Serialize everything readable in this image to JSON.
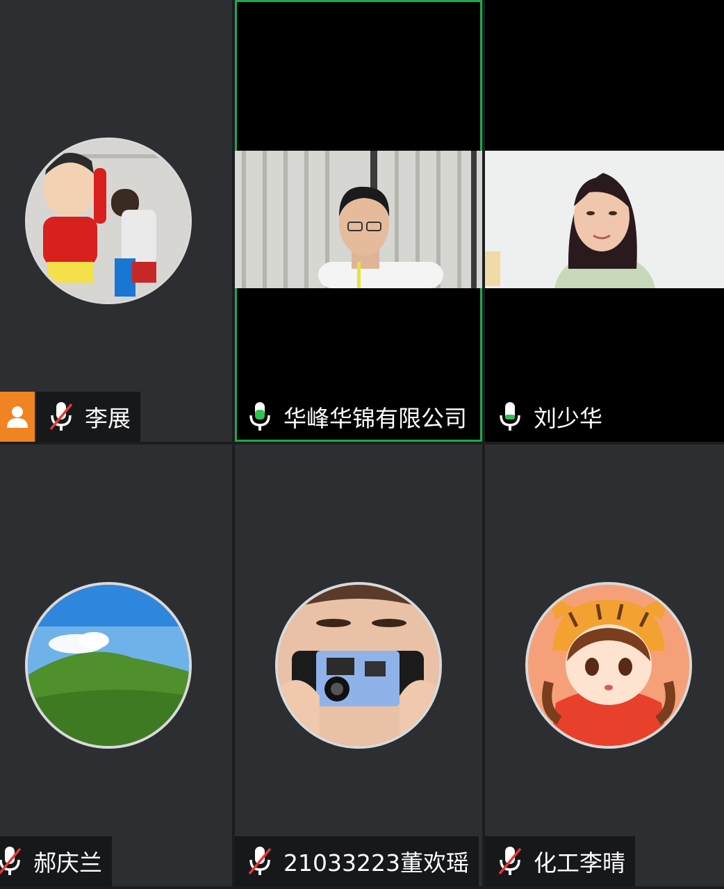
{
  "participants": [
    {
      "name": "李展",
      "mic": "muted",
      "host": true
    },
    {
      "name": "华峰华锦有限公司",
      "mic": "active",
      "active_speaker": true
    },
    {
      "name": "刘少华",
      "mic": "on"
    },
    {
      "name": "郝庆兰",
      "mic": "muted"
    },
    {
      "name": "21033223董欢瑶",
      "mic": "muted"
    },
    {
      "name": "化工李晴",
      "mic": "muted"
    }
  ],
  "colors": {
    "active_border": "#1fa84a",
    "host_badge": "#f08422",
    "muted_slash": "#e53935",
    "mic_level": "#2ec34f"
  }
}
